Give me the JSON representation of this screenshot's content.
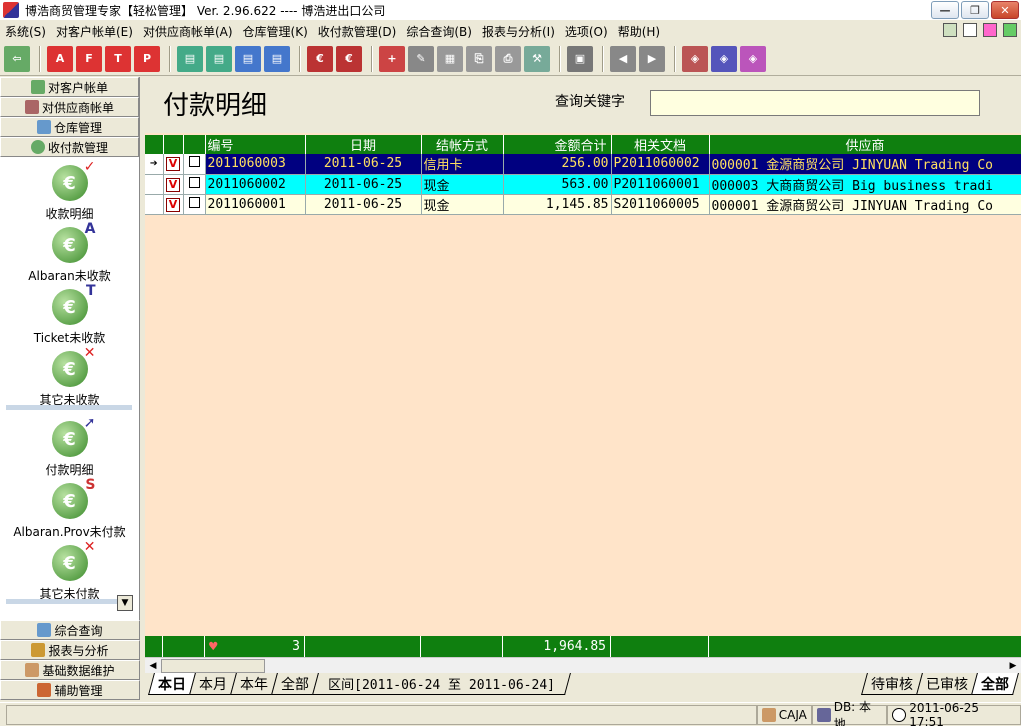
{
  "window": {
    "title": "博浩商贸管理专家【轻松管理】 Ver. 2.96.622 ---- 博浩进出口公司"
  },
  "menu": [
    "系统(S)",
    "对客户帐单(E)",
    "对供应商帐单(A)",
    "仓库管理(K)",
    "收付款管理(D)",
    "综合查询(B)",
    "报表与分析(I)",
    "选项(O)",
    "帮助(H)"
  ],
  "nav": {
    "top_sections": [
      "对客户帐单",
      "对供应商帐单",
      "仓库管理",
      "收付款管理"
    ],
    "tools": [
      "收款明细",
      "Albaran未收款",
      "Ticket未收款",
      "其它未收款",
      "付款明细",
      "Albaran.Prov未付款",
      "其它未付款"
    ],
    "bottom_sections": [
      "综合查询",
      "报表与分析",
      "基础数据维护",
      "辅助管理"
    ]
  },
  "main": {
    "title": "付款明细",
    "search_label": "查询关键字",
    "search_value": ""
  },
  "table": {
    "columns": [
      "编号",
      "日期",
      "结帐方式",
      "金额合计",
      "相关文档",
      "供应商"
    ],
    "rows": [
      {
        "indicator": "➔",
        "v": "V",
        "id": "2011060003",
        "date": "2011-06-25",
        "method": "信用卡",
        "amount": "256.00",
        "doc": "P2011060002",
        "supplier": "000001 金源商贸公司 JINYUAN Trading Co"
      },
      {
        "indicator": "",
        "v": "V",
        "id": "2011060002",
        "date": "2011-06-25",
        "method": "现金",
        "amount": "563.00",
        "doc": "P2011060001",
        "supplier": "000003 大商商贸公司 Big business tradi"
      },
      {
        "indicator": "",
        "v": "V",
        "id": "2011060001",
        "date": "2011-06-25",
        "method": "现金",
        "amount": "1,145.85",
        "doc": "S2011060005",
        "supplier": "000001 金源商贸公司 JINYUAN Trading Co"
      }
    ],
    "footer": {
      "count": "3",
      "total": "1,964.85"
    }
  },
  "tabs_left": [
    "本日",
    "本月",
    "本年",
    "全部",
    "区间[2011-06-24 至 2011-06-24]"
  ],
  "tabs_right": [
    "待审核",
    "已审核",
    "全部"
  ],
  "status": {
    "user": "CAJA",
    "db": "DB: 本地",
    "datetime": "2011-06-25 17:51"
  }
}
